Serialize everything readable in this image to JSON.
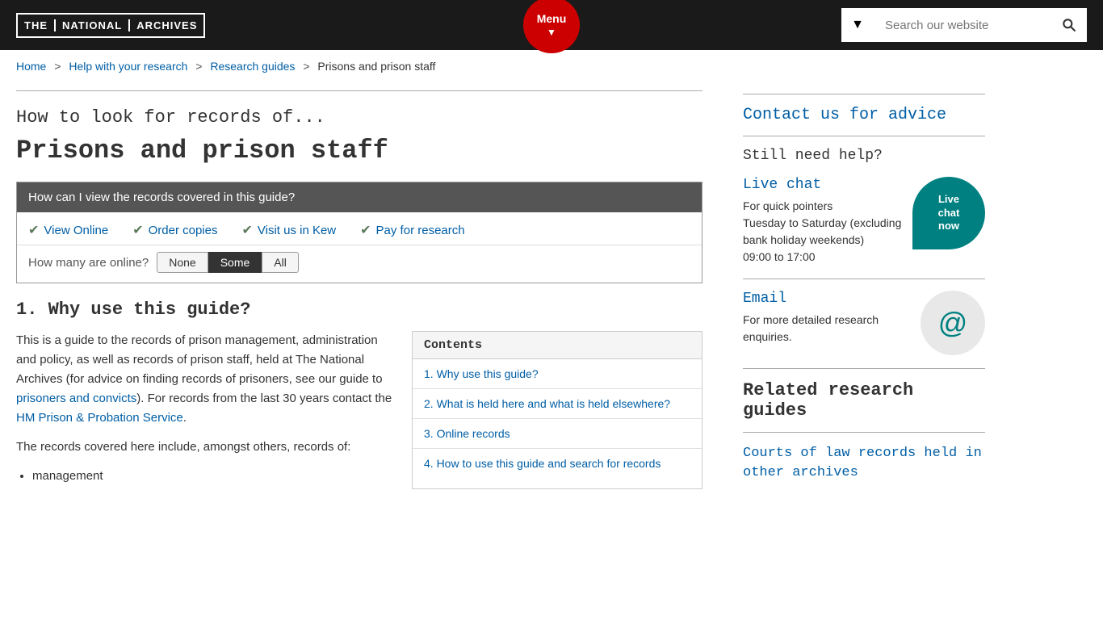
{
  "header": {
    "logo": {
      "part1": "THE",
      "part2": "NATIONAL",
      "part3": "ARCHIVES"
    },
    "menu_label": "Menu",
    "search_placeholder": "Search our website",
    "search_dropdown_label": "▼"
  },
  "breadcrumb": {
    "items": [
      {
        "label": "Home",
        "href": "#"
      },
      {
        "label": "Help with your research",
        "href": "#"
      },
      {
        "label": "Research guides",
        "href": "#"
      },
      {
        "label": "Prisons and prison staff",
        "href": null
      }
    ]
  },
  "content": {
    "how_to_label": "How to look for records of...",
    "page_title": "Prisons and prison staff",
    "guide_box": {
      "header": "How can I view the records covered in this guide?",
      "options": [
        {
          "label": "View Online",
          "check": "✔"
        },
        {
          "label": "Order copies",
          "check": "✔"
        },
        {
          "label": "Visit us in Kew",
          "check": "✔"
        },
        {
          "label": "Pay for research",
          "check": "✔"
        }
      ],
      "online_label": "How many are online?",
      "online_options": [
        {
          "label": "None",
          "active": false
        },
        {
          "label": "Some",
          "active": true
        },
        {
          "label": "All",
          "active": false
        }
      ]
    },
    "section1": {
      "title": "1.  Why use this guide?",
      "paragraphs": [
        "This is a guide to the records of prison management, administration and policy, as well as records of prison staff, held at The National Archives (for advice on finding records of prisoners, see our guide to prisoners and convicts). For records from the last 30 years contact the HM Prison & Probation Service.",
        "The records covered here include, amongst others, records of:"
      ],
      "list_items": [
        "management"
      ],
      "links": [
        {
          "label": "prisoners and convicts",
          "href": "#"
        },
        {
          "label": "HM Prison & Probation Service",
          "href": "#"
        }
      ]
    },
    "contents": {
      "header": "Contents",
      "items": [
        {
          "label": "1. Why use this guide?",
          "href": "#"
        },
        {
          "label": "2. What is held here and what is held elsewhere?",
          "href": "#"
        },
        {
          "label": "3. Online records",
          "href": "#"
        },
        {
          "label": "4. How to use this guide and search for records",
          "href": "#"
        }
      ]
    }
  },
  "sidebar": {
    "contact_link": "Contact us for advice",
    "still_help": "Still need help?",
    "live_chat": {
      "title": "Live chat",
      "bubble_line1": "Live",
      "bubble_line2": "chat",
      "bubble_line3": "now",
      "desc_line1": "For quick pointers",
      "desc_line2": "Tuesday to Saturday (excluding bank holiday weekends)",
      "desc_line3": "09:00 to 17:00"
    },
    "email": {
      "title": "Email",
      "desc": "For more detailed research enquiries.",
      "icon": "@"
    },
    "related": {
      "title": "Related research guides",
      "links": [
        {
          "label": "Courts of law records held in other archives",
          "href": "#"
        }
      ]
    }
  }
}
